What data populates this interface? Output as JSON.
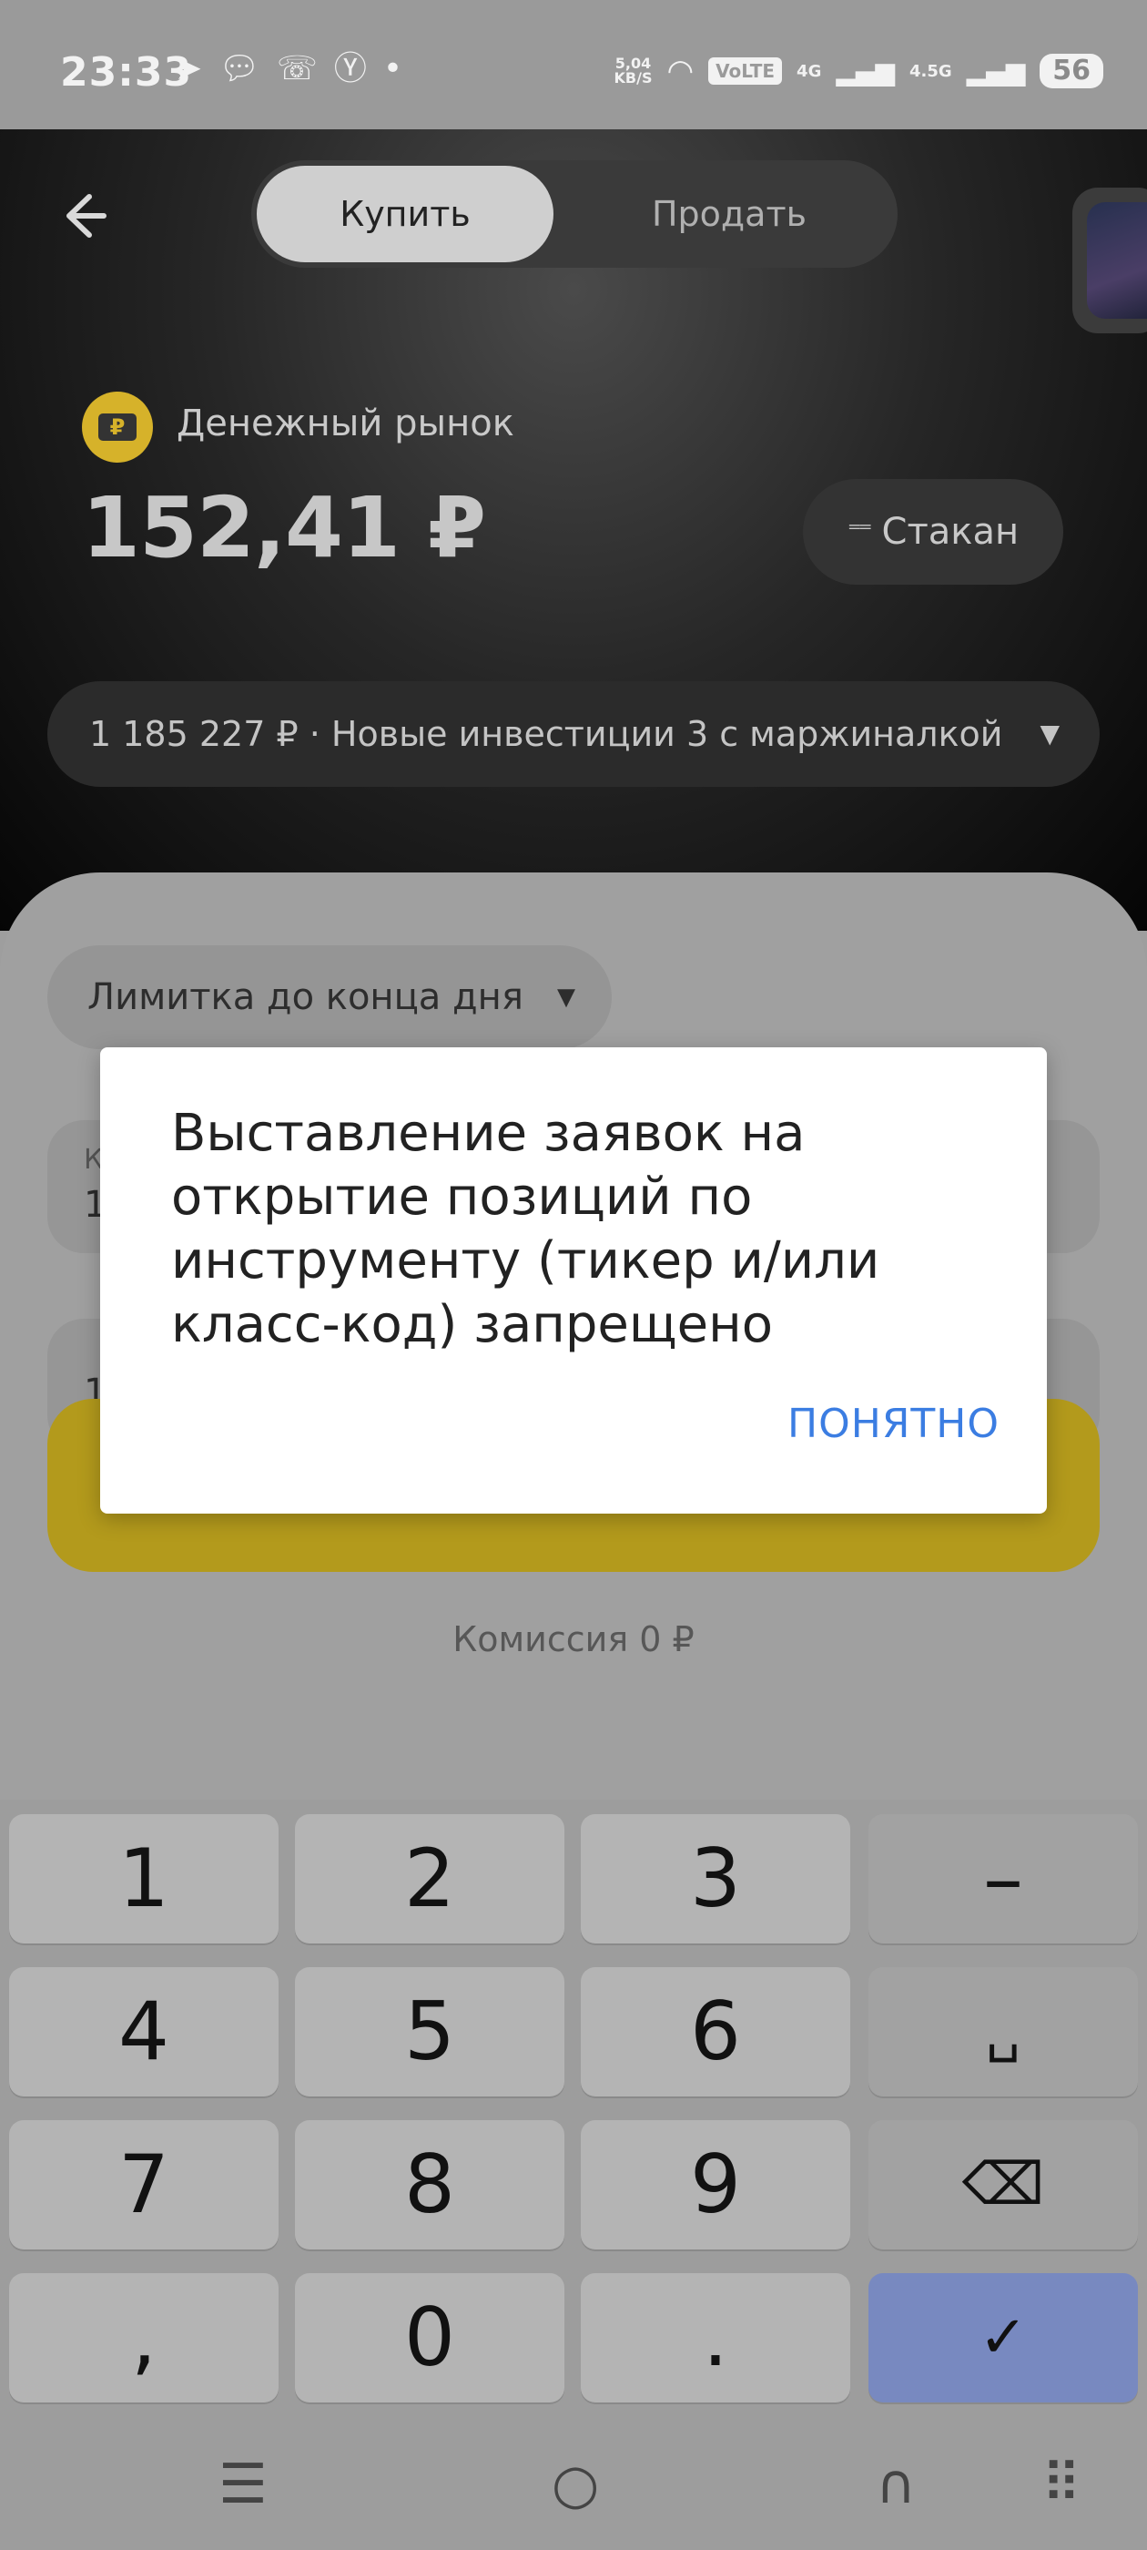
{
  "status_bar": {
    "time": "23:33",
    "app_icons": [
      "telegram-icon",
      "chat-bubble-icon",
      "missed-call-icon",
      "yandex-icon",
      "dot-icon"
    ],
    "net_speed_value": "5,04",
    "net_speed_unit": "KB/S",
    "volte": "VoLTE",
    "sim1_tag": "4G",
    "sim2_tag": "4.5G",
    "battery": "56"
  },
  "header": {
    "back_icon": "arrow-left-icon",
    "tabs": {
      "buy": "Купить",
      "sell": "Продать"
    },
    "instrument_name": "Денежный рынок",
    "instrument_icon_symbol": "₽",
    "price": "152,41 ₽",
    "stakan_label": "Стакан",
    "account": "1 185 227 ₽ · Новые инвестиции 3 с маржиналкой"
  },
  "order": {
    "order_type": "Лимитка до конца дня",
    "field1_label": "К",
    "field1_value": "1",
    "field2_value": "1",
    "commission": "Комиссия 0 ₽"
  },
  "keyboard": {
    "keys": [
      "1",
      "2",
      "3",
      "–",
      "4",
      "5",
      "6",
      "␣",
      "7",
      "8",
      "9",
      "⌫",
      ",",
      "0",
      ".",
      "✓"
    ]
  },
  "nav_bar": {
    "menu": "☰",
    "home": "○",
    "back": "∩",
    "keyboard": "⠿"
  },
  "dialog": {
    "message": "Выставление заявок на открытие позиций по инструменту (тикер и/или класс-код) запрещено",
    "ok_label": "ПОНЯТНО"
  }
}
